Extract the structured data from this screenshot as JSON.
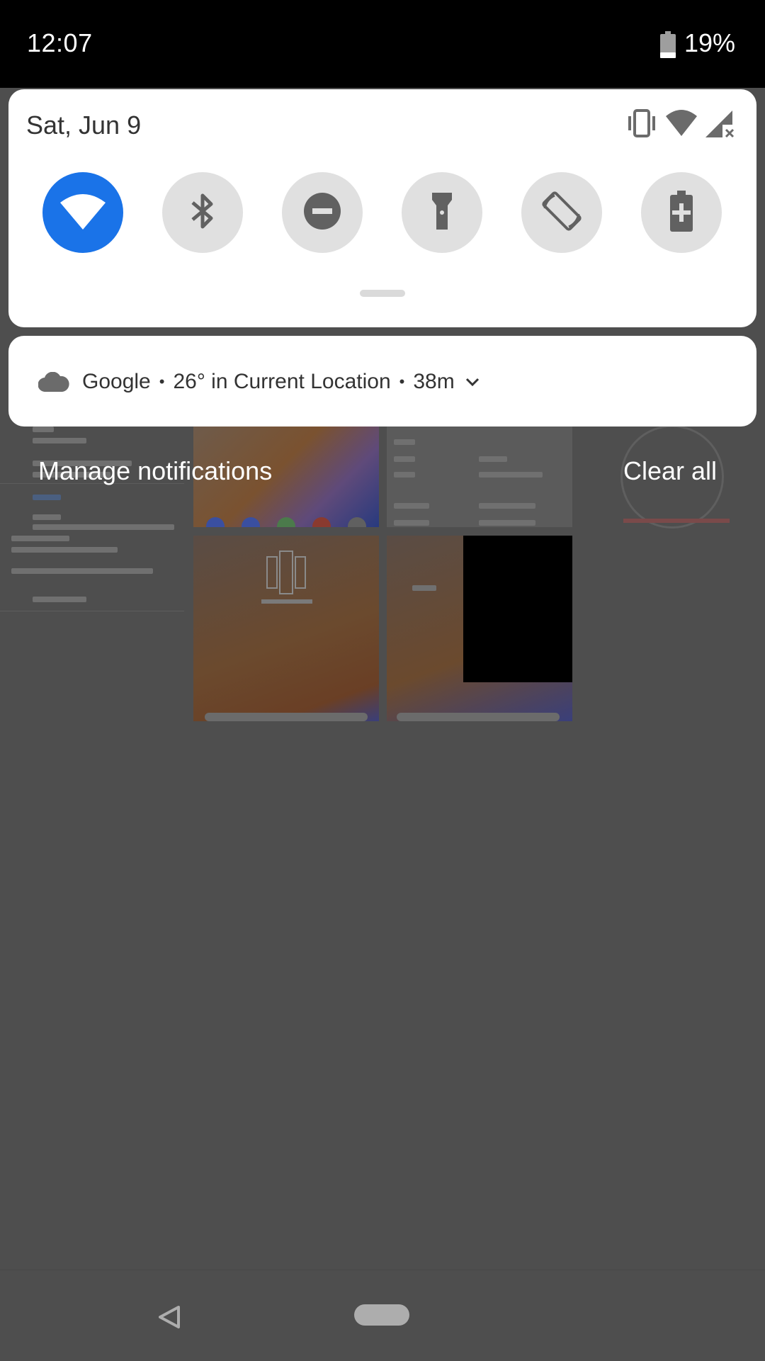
{
  "status_bar": {
    "time": "12:07",
    "battery_percent": "19%",
    "battery_level": 0.19
  },
  "quick_settings": {
    "date": "Sat, Jun 9",
    "system_icons": [
      "vibrate-icon",
      "wifi-signal-icon",
      "cell-signal-no-data-icon"
    ],
    "tiles": [
      {
        "name": "wifi",
        "icon": "wifi-icon",
        "active": true
      },
      {
        "name": "bluetooth",
        "icon": "bluetooth-icon",
        "active": false
      },
      {
        "name": "do-not-disturb",
        "icon": "do-not-disturb-icon",
        "active": false
      },
      {
        "name": "flashlight",
        "icon": "flashlight-icon",
        "active": false
      },
      {
        "name": "auto-rotate",
        "icon": "auto-rotate-icon",
        "active": false
      },
      {
        "name": "battery-saver",
        "icon": "battery-saver-icon",
        "active": false
      }
    ],
    "colors": {
      "active_tile": "#1a73e8",
      "inactive_tile": "#e0e0e0",
      "icon": "#616161"
    }
  },
  "notification": {
    "icon": "cloud-icon",
    "app": "Google",
    "temperature": "26° in Current Location",
    "age": "38m",
    "separator": "•"
  },
  "footer": {
    "manage_label": "Manage notifications",
    "clear_label": "Clear all"
  },
  "nav_bar": {
    "back_icon": "back-triangle-icon",
    "home_icon": "home-pill-icon"
  }
}
